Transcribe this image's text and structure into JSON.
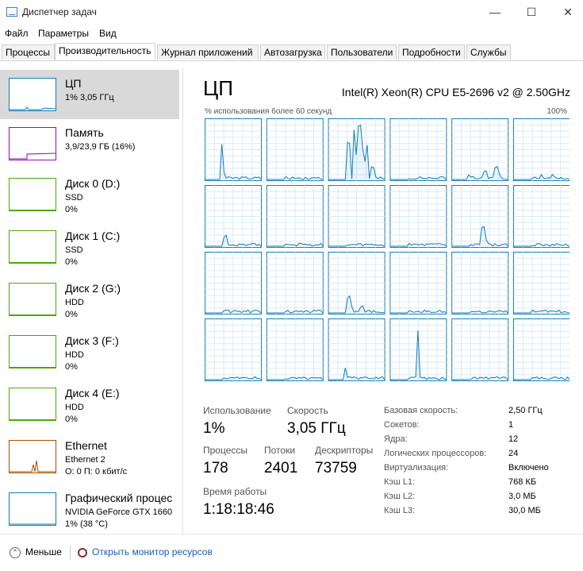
{
  "window": {
    "title": "Диспетчер задач"
  },
  "menu": [
    "Файл",
    "Параметры",
    "Вид"
  ],
  "tabs": [
    "Процессы",
    "Производительность",
    "Журнал приложений",
    "Автозагрузка",
    "Пользователи",
    "Подробности",
    "Службы"
  ],
  "resources": [
    {
      "title": "ЦП",
      "sub1": "1% 3,05 ГГц",
      "sub2": "",
      "color": "#117dbb"
    },
    {
      "title": "Память",
      "sub1": "3,9/23,9 ГБ (16%)",
      "sub2": "",
      "color": "#8b12ae"
    },
    {
      "title": "Диск 0 (D:)",
      "sub1": "SSD",
      "sub2": "0%",
      "color": "#4da60c"
    },
    {
      "title": "Диск 1 (C:)",
      "sub1": "SSD",
      "sub2": "0%",
      "color": "#4da60c"
    },
    {
      "title": "Диск 2 (G:)",
      "sub1": "HDD",
      "sub2": "0%",
      "color": "#4da60c"
    },
    {
      "title": "Диск 3 (F:)",
      "sub1": "HDD",
      "sub2": "0%",
      "color": "#4da60c"
    },
    {
      "title": "Диск 4 (E:)",
      "sub1": "HDD",
      "sub2": "0%",
      "color": "#4da60c"
    },
    {
      "title": "Ethernet",
      "sub1": "Ethernet 2",
      "sub2": "О: 0 П: 0 кбит/с",
      "color": "#a74f01"
    },
    {
      "title": "Графический процес",
      "sub1": "NVIDIA GeForce GTX 1660",
      "sub2": "1% (38 °C)",
      "color": "#117dbb"
    }
  ],
  "cpu": {
    "title": "ЦП",
    "model": "Intel(R) Xeon(R) CPU E5-2696 v2 @ 2.50GHz",
    "util_label": "% использования более 60 секунд",
    "util_max": "100%",
    "stats": {
      "usage_label": "Использование",
      "usage": "1%",
      "speed_label": "Скорость",
      "speed": "3,05 ГГц",
      "processes_label": "Процессы",
      "processes": "178",
      "threads_label": "Потоки",
      "threads": "2401",
      "handles_label": "Дескрипторы",
      "handles": "73759",
      "uptime_label": "Время работы",
      "uptime": "1:18:18:46"
    },
    "details": [
      {
        "label": "Базовая скорость:",
        "value": "2,50 ГГц"
      },
      {
        "label": "Сокетов:",
        "value": "1"
      },
      {
        "label": "Ядра:",
        "value": "12"
      },
      {
        "label": "Логических процессоров:",
        "value": "24"
      },
      {
        "label": "Виртуализация:",
        "value": "Включено"
      },
      {
        "label": "Кэш L1:",
        "value": "768 КБ"
      },
      {
        "label": "Кэш L2:",
        "value": "3,0 МБ"
      },
      {
        "label": "Кэш L3:",
        "value": "30,0 МБ"
      }
    ]
  },
  "footer": {
    "fewer": "Меньше",
    "monitor": "Открыть монитор ресурсов"
  },
  "colors": {
    "cpu_line": "#117dbb",
    "cpu_grid": "#d9eaf7",
    "cpu_border": "#117dbb"
  }
}
